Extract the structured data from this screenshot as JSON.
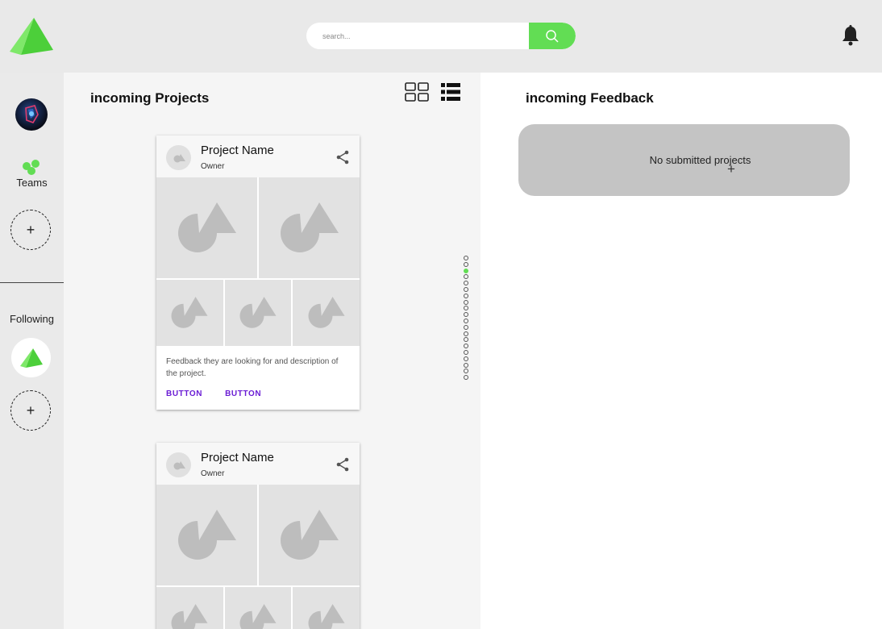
{
  "search": {
    "placeholder": "search..."
  },
  "sidebar": {
    "teams_label": "Teams",
    "following_label": "Following",
    "add_symbol": "+"
  },
  "projects": {
    "title": "incoming Projects",
    "cards": [
      {
        "name": "Project Name",
        "owner": "Owner",
        "description": "Feedback they are looking for and description of the project.",
        "button_1": "BUTTON",
        "button_2": "BUTTON"
      },
      {
        "name": "Project Name",
        "owner": "Owner"
      }
    ]
  },
  "pager": {
    "total_dots": 20,
    "active_index": 2
  },
  "feedback": {
    "title": "incoming Feedback",
    "empty_text": "No submitted projects",
    "add_symbol": "+"
  },
  "colors": {
    "accent": "#62dd54",
    "button_text": "#6a1cd4",
    "placeholder_gray": "#bdbdbd"
  },
  "icons": [
    "logo-icon",
    "search-icon",
    "bell-icon",
    "teams-icon",
    "grid-view-icon",
    "list-view-icon",
    "share-icon",
    "placeholder-image-icon"
  ]
}
